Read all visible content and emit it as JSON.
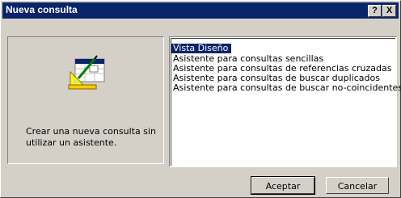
{
  "dialog": {
    "title": "Nueva consulta",
    "help_label": "?",
    "close_label": "X"
  },
  "preview": {
    "icon": "query-design-icon",
    "description": "Crear una nueva consulta sin utilizar un asistente."
  },
  "options": [
    {
      "label": "Vista Diseño",
      "selected": true
    },
    {
      "label": "Asistente para consultas sencillas",
      "selected": false
    },
    {
      "label": "Asistente para consultas de referencias cruzadas",
      "selected": false
    },
    {
      "label": "Asistente para consultas de buscar duplicados",
      "selected": false
    },
    {
      "label": "Asistente para consultas de buscar no-coincidentes",
      "selected": false
    }
  ],
  "buttons": {
    "ok": "Aceptar",
    "cancel": "Cancelar"
  },
  "colors": {
    "titlebar": "#0a246a",
    "selection": "#0a246a",
    "face": "#d4d0c8"
  }
}
